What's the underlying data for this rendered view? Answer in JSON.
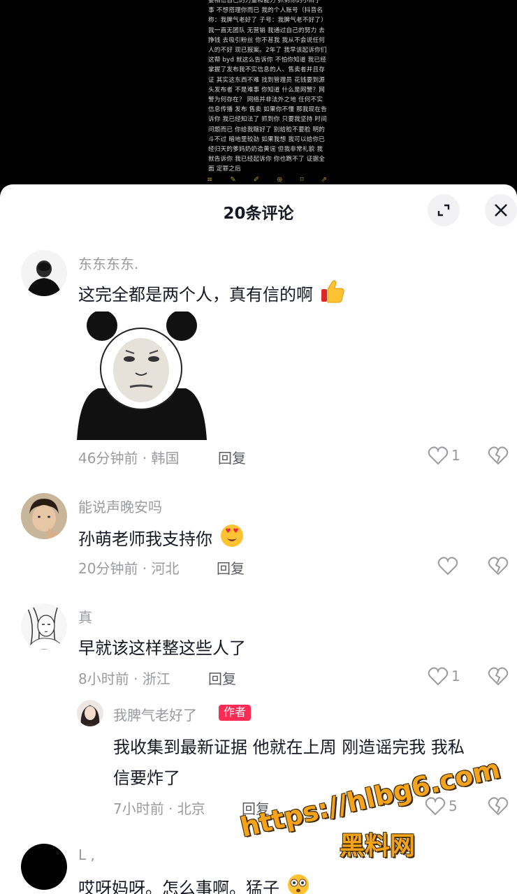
{
  "video": {
    "text": "要相信自己的力量和能力 抓到你的小辫子 事 不想搭理你而已 我的个人账号（抖音名称：我脾气老好了 子号：我脾气老不好了）我一直无团队 无营销 我通过自己的努力 去挣钱 去吸引粉丝 你不甚我 我从不会说任何人的不好 现已报案。2年了 我早该起诉你们这帮 byd 就这么告诉你 不怕你知道 我已经掌握了发布我不实信息的人、售卖者并且存证 其实这东西不难 找到管理员 花钱要到源头发布者 不是难事 你知道 什么是网警？网警为何存在？ 网络并非法外之地 任何不实信息传播 发布 售卖 如果你不懂 那我现在告诉你 我已经知法了 抓到你 只要我坚持 时间问题而已 你给我瞎好了 别给脸不要脸 明的斗不过 暗地里较劲 如果我想 我可以给你已经归天的爹妈奶奶造黄谣 但我非常礼貌 我就告诉你 我已经起诉你 你也跑不了 证据全面 定罪之后"
  },
  "sheet": {
    "title": "20条评论"
  },
  "comments": [
    {
      "name": "东东东东.",
      "text": "这完全都是两个人，真有信的啊",
      "time": "46分钟前 · 韩国",
      "reply": "回复",
      "likes": "1"
    },
    {
      "name": "能说声晚安吗",
      "text": "孙萌老师我支持你",
      "time": "20分钟前 · 河北",
      "reply": "回复",
      "likes": ""
    },
    {
      "name": "真",
      "text": "早就该这样整这些人了",
      "time": "8小时前 · 浙江",
      "reply": "回复",
      "likes": "1"
    }
  ],
  "reply": {
    "name": "我脾气老好了",
    "tag": "作者",
    "text_line1": "我收集到最新证据 他就在上周 刚造谣完我 我私",
    "text_line2": "信要炸了",
    "time": "7小时前 · 北京",
    "reply": "回复",
    "likes": "5"
  },
  "last_comment": {
    "name": "L ,",
    "text": "哎呀妈呀。怎么事啊。猛子"
  },
  "watermark": {
    "url": "https://hlbg6.com",
    "label": "黑料网"
  },
  "colors": {
    "accent": "#fe2c55",
    "watermark": "#f5a31a"
  },
  "icons": [
    "expand-icon",
    "close-icon",
    "heart-icon",
    "broken-heart-icon",
    "thumbs-up-emoji",
    "heart-eyes-emoji",
    "flushed-emoji"
  ]
}
